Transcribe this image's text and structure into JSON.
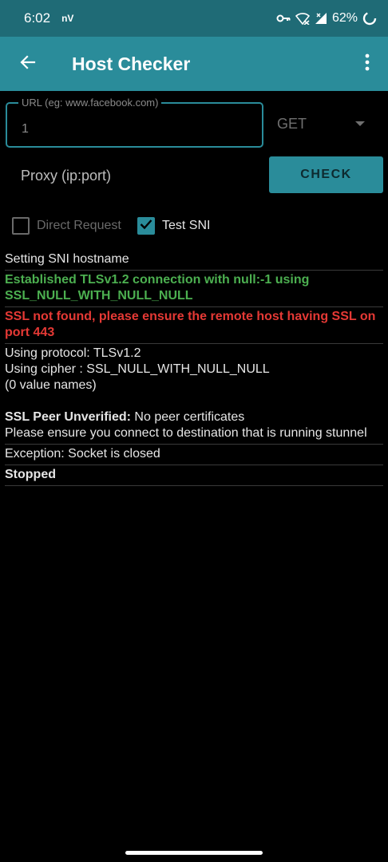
{
  "status": {
    "time": "6:02",
    "carrier": "nV",
    "battery": "62%"
  },
  "appbar": {
    "title": "Host Checker"
  },
  "form": {
    "url_label": "URL (eg: www.facebook.com)",
    "url_value": "1",
    "method": "GET",
    "proxy_placeholder": "Proxy (ip:port)",
    "check_label": "CHECK",
    "direct_request_label": "Direct Request",
    "direct_request_checked": false,
    "test_sni_label": "Test SNI",
    "test_sni_checked": true
  },
  "log": {
    "sni": "Setting SNI hostname",
    "established": "Established TLSv1.2 connection with null:-1 using SSL_NULL_WITH_NULL_NULL",
    "ssl_not_found": "SSL not found, please ensure the remote host having SSL on port 443",
    "protocol": "Using protocol: TLSv1.2",
    "cipher": "Using cipher : SSL_NULL_WITH_NULL_NULL",
    "value_names": "(0 value names)",
    "peer_label": "SSL Peer Unverified:",
    "peer_detail": " No peer certificates",
    "peer_hint": "Please ensure you connect to destination that is running stunnel",
    "exception": "Exception: Socket is closed",
    "stopped": "Stopped"
  },
  "colors": {
    "status_bar": "#1f6b76",
    "app_bar": "#2a8c9a",
    "success": "#4caf50",
    "error": "#e53935"
  },
  "icons": [
    "arrow-back-icon",
    "more-vert-icon",
    "vpn-key-icon",
    "wifi-icon",
    "signal-icon",
    "battery-saver-icon",
    "check-icon"
  ]
}
